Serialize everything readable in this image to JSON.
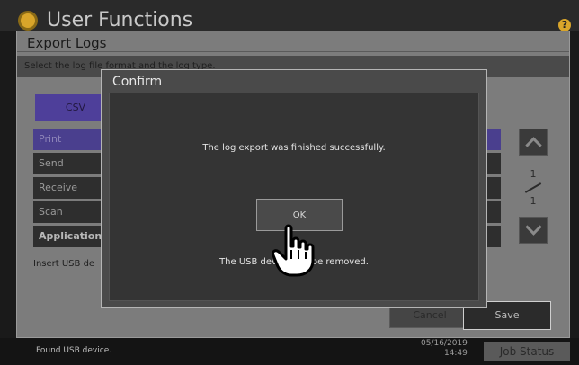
{
  "header": {
    "title": "User Functions",
    "help_icon": "help-icon"
  },
  "panel": {
    "title": "Export Logs",
    "instruction": "Select the log file format and the log type.",
    "format_button": "CSV",
    "log_types": [
      "Print",
      "Send",
      "Receive",
      "Scan",
      "Application"
    ],
    "selected_log_type": "Print",
    "page_current": "1",
    "page_total": "1",
    "usb_note": "Insert USB de",
    "cancel_label": "Cancel",
    "save_label": "Save"
  },
  "dialog": {
    "title": "Confirm",
    "message": "The log export was finished successfully.",
    "ok_label": "OK",
    "usb_message": "The USB device can be removed."
  },
  "statusbar": {
    "message": "Found USB device.",
    "date": "05/16/2019",
    "time": "14:49",
    "job_status_label": "Job Status"
  },
  "colors": {
    "accent": "#4e3f9a",
    "gear": "#d9a52a"
  }
}
